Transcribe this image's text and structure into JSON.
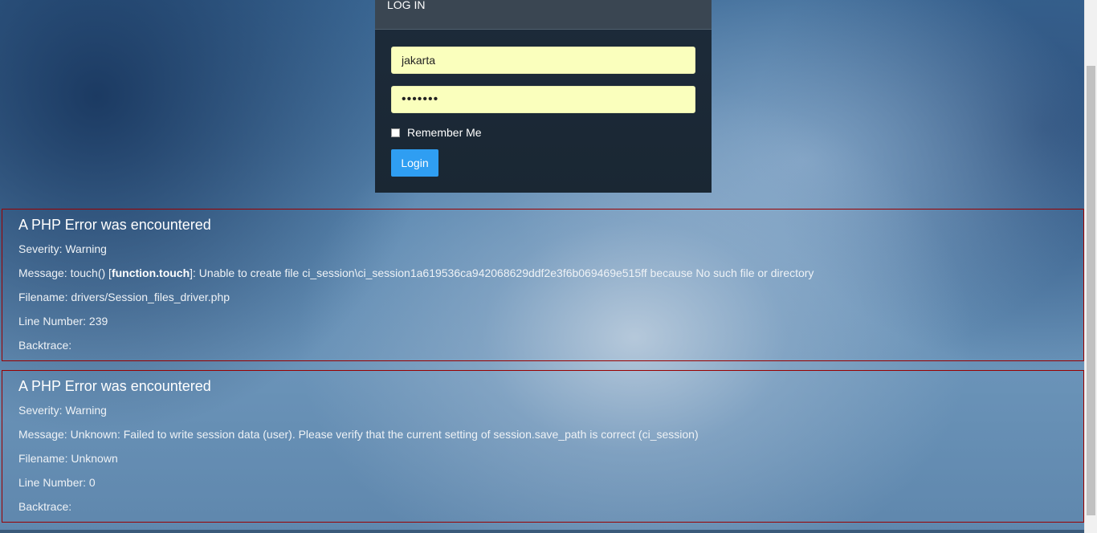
{
  "login": {
    "header": "LOG IN",
    "username_value": "jakarta",
    "password_value": "•••••••",
    "remember_label": "Remember Me",
    "login_button": "Login"
  },
  "errors": [
    {
      "title": "A PHP Error was encountered",
      "severity": "Severity: Warning",
      "message_prefix": "Message: touch() [",
      "message_link": "function.touch",
      "message_suffix": "]: Unable to create file ci_session\\ci_session1a619536ca942068629ddf2e3f6b069469e515ff because No such file or directory",
      "filename": "Filename: drivers/Session_files_driver.php",
      "line_number": "Line Number: 239",
      "backtrace": "Backtrace:"
    },
    {
      "title": "A PHP Error was encountered",
      "severity": "Severity: Warning",
      "message": "Message: Unknown: Failed to write session data (user). Please verify that the current setting of session.save_path is correct (ci_session)",
      "filename": "Filename: Unknown",
      "line_number": "Line Number: 0",
      "backtrace": "Backtrace:"
    }
  ],
  "colors": {
    "login_button": "#2f9ef2",
    "autofill_input": "#faffbd",
    "error_border": "#990000",
    "panel_background": "#1d2b3a"
  }
}
